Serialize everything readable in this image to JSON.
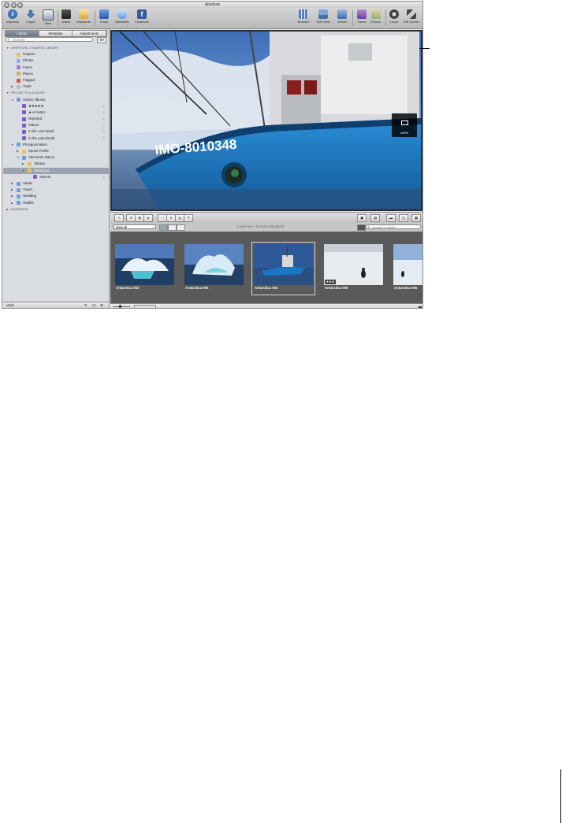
{
  "window": {
    "title": "Aperture"
  },
  "toolbar": {
    "inspector": "Inspector",
    "import": "Import",
    "new": "New",
    "name": "Name",
    "keywords": "Keywords",
    "email": "Email",
    "mobileme": "MobileMe",
    "facebook": "Facebook",
    "browser": "Browser",
    "split_view": "Split View",
    "viewer": "Viewer",
    "faces": "Faces",
    "places": "Places",
    "loupe": "Loupe",
    "full_screen": "Full Screen"
  },
  "inspector_tabs": [
    "Library",
    "Metadata",
    "Adjustments"
  ],
  "search": {
    "placeholder": "All Items"
  },
  "library": {
    "header": "APERTURE 3 SAMPLE LIBRARY",
    "items": [
      "Projects",
      "Photos",
      "Faces",
      "Places",
      "Flagged",
      "Trash"
    ]
  },
  "projects": {
    "header": "PROJECTS & ALBUMS",
    "library_albums": "Library Albums",
    "smart_albums": [
      "★★★★★",
      "★ or better",
      "Rejected",
      "Videos",
      "In the Last Week",
      "In the Last Month"
    ],
    "photojournalism": "Photojournalism",
    "sports_profile": "Sports Profile",
    "adventure_races": "Adventure Races",
    "sahara": "Sahara",
    "antarctica": "Antarctica",
    "selects": "Selects",
    "folders": [
      "Studio",
      "Travel",
      "Wedding",
      "Wildlife"
    ]
  },
  "facebook_header": "FACEBOOK",
  "vault": "Vault",
  "viewer": {
    "zoom": "100%",
    "hull_text": "IMO-8010348"
  },
  "browser": {
    "sort": "Manual",
    "status": "1 selected – 82 items displayed",
    "rating_filter": "Unrated or Better"
  },
  "thumbnails": [
    {
      "caption": "Antarctica 002",
      "selected": false,
      "stars": ""
    },
    {
      "caption": "Antarctica 003",
      "selected": false,
      "stars": ""
    },
    {
      "caption": "Antarctica 004",
      "selected": true,
      "stars": ""
    },
    {
      "caption": "Antarctica 005",
      "selected": false,
      "stars": "★★★"
    },
    {
      "caption": "Antarctica 006",
      "selected": false,
      "stars": ""
    }
  ],
  "colors": {
    "accent_blue": "#1f6fb5",
    "sidebar_bg": "#d9dce1",
    "filmstrip_bg": "#5a5a5a"
  }
}
